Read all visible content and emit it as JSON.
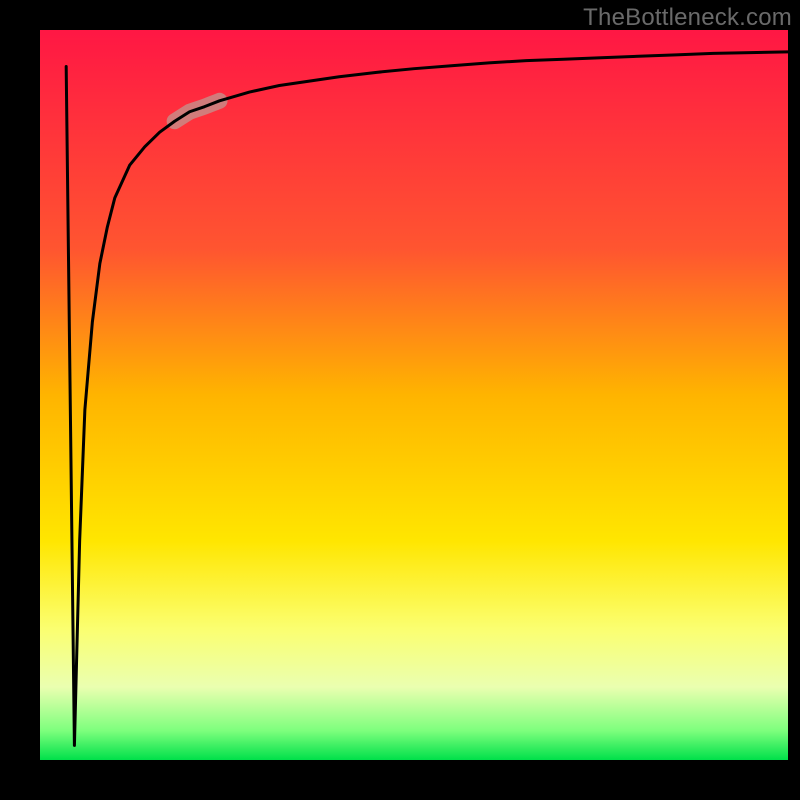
{
  "watermark": "TheBottleneck.com",
  "chart_data": {
    "type": "line",
    "title": "",
    "xlabel": "",
    "ylabel": "",
    "xlim": [
      0,
      100
    ],
    "ylim": [
      0,
      100
    ],
    "grid": false,
    "legend": false,
    "description": "Bottleneck curve overlaid on a vertical red→yellow→green gradient. One narrow V-shaped dip near the left edge drops to ~0 (the green zone, meaning no bottleneck) then rises steeply and asymptotically approaches ~97. A short pink capsule sits on the rising part of the curve around x≈18–24.",
    "gradient_stops": [
      {
        "offset": 0,
        "color": "#ff1744"
      },
      {
        "offset": 30,
        "color": "#ff5530"
      },
      {
        "offset": 50,
        "color": "#ffb400"
      },
      {
        "offset": 70,
        "color": "#ffe600"
      },
      {
        "offset": 82,
        "color": "#fbff70"
      },
      {
        "offset": 90,
        "color": "#eaffb0"
      },
      {
        "offset": 96,
        "color": "#7dff7d"
      },
      {
        "offset": 100,
        "color": "#00e04a"
      }
    ],
    "highlight_segment": {
      "x_start": 18,
      "x_end": 24,
      "color": "#c98a86"
    },
    "series": [
      {
        "name": "bottleneck_pct",
        "x": [
          3.5,
          4.6,
          5.3,
          6.0,
          7.0,
          8.0,
          9.0,
          10.0,
          12.0,
          14.0,
          16.0,
          18.0,
          20.0,
          22.0,
          24.0,
          28.0,
          32.0,
          36.0,
          40.0,
          45.0,
          50.0,
          55.0,
          60.0,
          65.0,
          70.0,
          75.0,
          80.0,
          85.0,
          90.0,
          95.0,
          100.0
        ],
        "values": [
          95.0,
          2.0,
          30.0,
          48.0,
          60.0,
          68.0,
          73.0,
          77.0,
          81.5,
          84.0,
          86.0,
          87.5,
          88.8,
          89.5,
          90.3,
          91.5,
          92.4,
          93.0,
          93.6,
          94.2,
          94.7,
          95.1,
          95.5,
          95.8,
          96.0,
          96.2,
          96.4,
          96.6,
          96.8,
          96.9,
          97.0
        ]
      }
    ]
  }
}
